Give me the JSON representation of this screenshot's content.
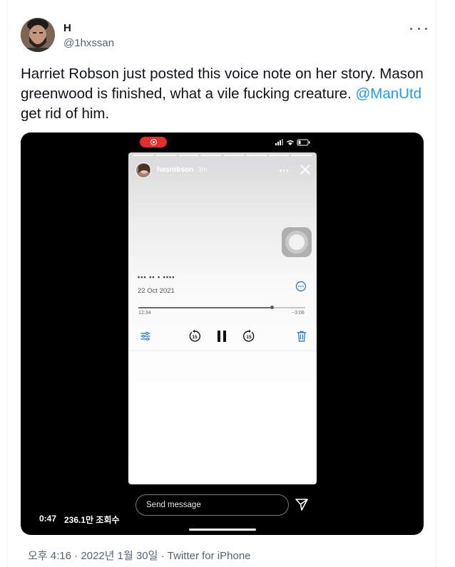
{
  "author": {
    "name": "H",
    "handle": "@1hxssan"
  },
  "tweet": {
    "text_main": "Harriet Robson just posted this voice note on her story. Mason greenwood is finished, what a vile fucking creature. ",
    "mention": "@ManUtd",
    "text_end": " get rid of him."
  },
  "video": {
    "elapsed": "0:47",
    "views": "236.1만 조회수"
  },
  "story": {
    "username": "hasrobson",
    "posted_ago": "3m",
    "reply_placeholder": "Send message",
    "progress_segments": 8
  },
  "voice_memo": {
    "date": "22 Oct 2021",
    "time_elapsed": "12:34",
    "time_remaining": "−3:06",
    "progress_fraction": 0.8,
    "skip_back_seconds": "15",
    "skip_forward_seconds": "15",
    "accent_color": "#1a73c9"
  },
  "meta": {
    "time": "오후 4:16",
    "date": "2022년 1월 30일",
    "separator": " · ",
    "client": "Twitter for iPhone"
  },
  "colors": {
    "link": "#1d9bf0",
    "recording_indicator": "#e0302e"
  }
}
